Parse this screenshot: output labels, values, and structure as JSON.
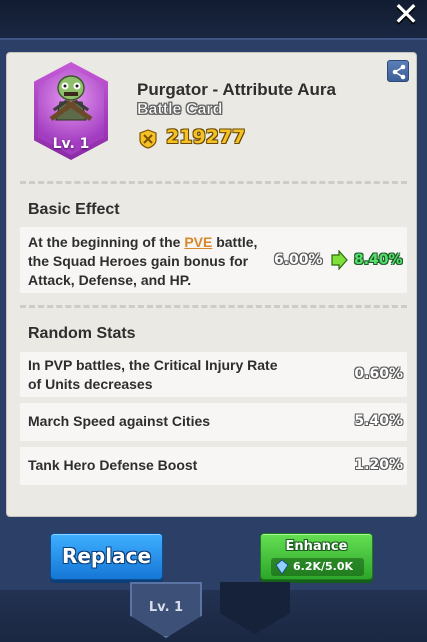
{
  "dialog": {
    "close_icon": "close-icon",
    "share_icon": "share-icon"
  },
  "card": {
    "level_label": "Lv. 1",
    "title": "Purgator - Attribute Aura",
    "subtitle": "Battle Card",
    "power_icon": "power-icon",
    "power_value": "219277"
  },
  "basic_effect": {
    "heading": "Basic Effect",
    "text_before": "At the beginning of the ",
    "text_highlight": "PVE",
    "text_after": " battle, the Squad Heroes gain bonus for Attack, Defense, and HP.",
    "value_current": "6.00%",
    "value_next": "8.40%",
    "arrow_icon": "arrow-right-icon"
  },
  "random_stats": {
    "heading": "Random Stats",
    "rows": [
      {
        "label": "In PVP battles, the Critical Injury Rate of Units decreases",
        "value": "0.60%"
      },
      {
        "label": "March Speed against Cities",
        "value": "5.40%"
      },
      {
        "label": "Tank Hero Defense Boost",
        "value": "1.20%"
      }
    ]
  },
  "actions": {
    "replace_label": "Replace",
    "enhance_label": "Enhance",
    "enhance_cost": "6.2K/5.0K",
    "enhance_cost_icon": "material-icon"
  },
  "background": {
    "badge_level": "Lv. 1"
  },
  "colors": {
    "accent_gold": "#f5c126",
    "increase_green": "#56e06b",
    "highlight_orange": "#d8892b",
    "replace_blue": "#1576d6",
    "enhance_green": "#2da62a"
  }
}
